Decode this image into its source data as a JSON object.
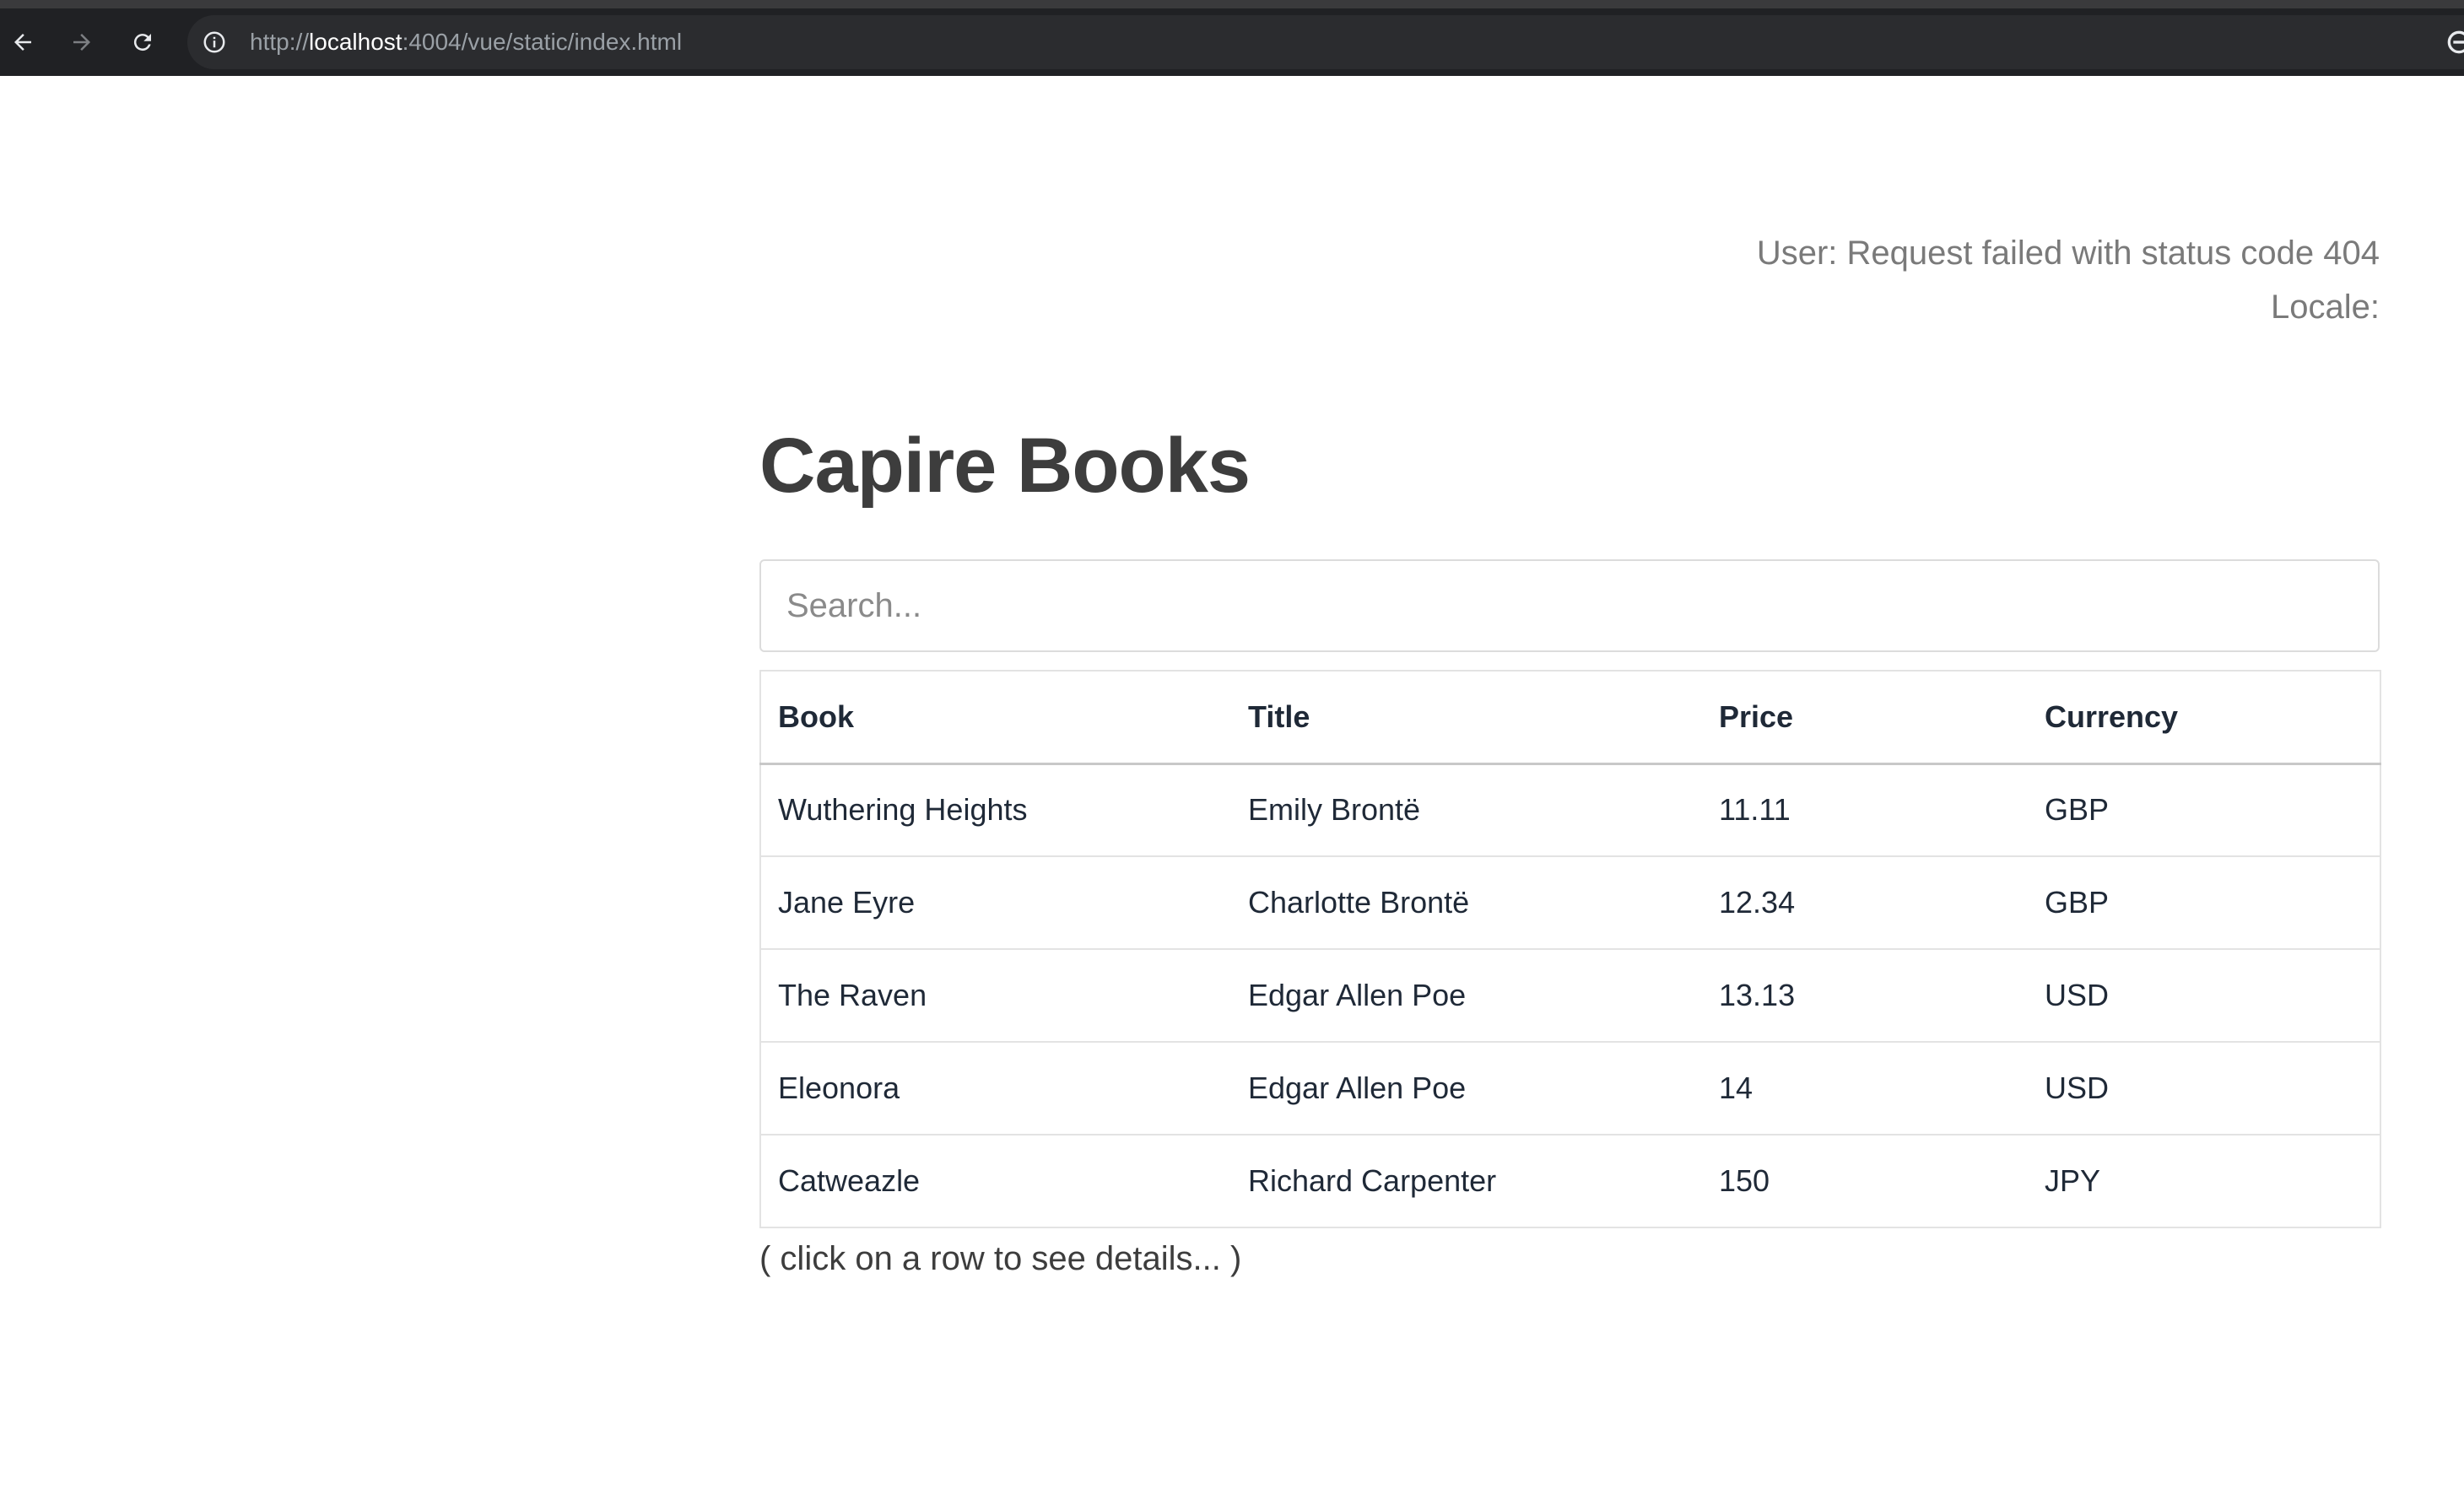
{
  "browser": {
    "url_scheme": "http://",
    "url_host": "localhost",
    "url_rest": ":4004/vue/static/index.html"
  },
  "status": {
    "user": "User: Request failed with status code 404",
    "locale": "Locale:"
  },
  "page": {
    "title": "Capire Books",
    "search_placeholder": "Search...",
    "hint": "( click on a row to see details... )"
  },
  "table": {
    "headers": [
      "Book",
      "Title",
      "Price",
      "Currency"
    ],
    "rows": [
      [
        "Wuthering Heights",
        "Emily Brontë",
        "11.11",
        "GBP"
      ],
      [
        "Jane Eyre",
        "Charlotte Brontë",
        "12.34",
        "GBP"
      ],
      [
        "The Raven",
        "Edgar Allen Poe",
        "13.13",
        "USD"
      ],
      [
        "Eleonora",
        "Edgar Allen Poe",
        "14",
        "USD"
      ],
      [
        "Catweazle",
        "Richard Carpenter",
        "150",
        "JPY"
      ]
    ]
  }
}
